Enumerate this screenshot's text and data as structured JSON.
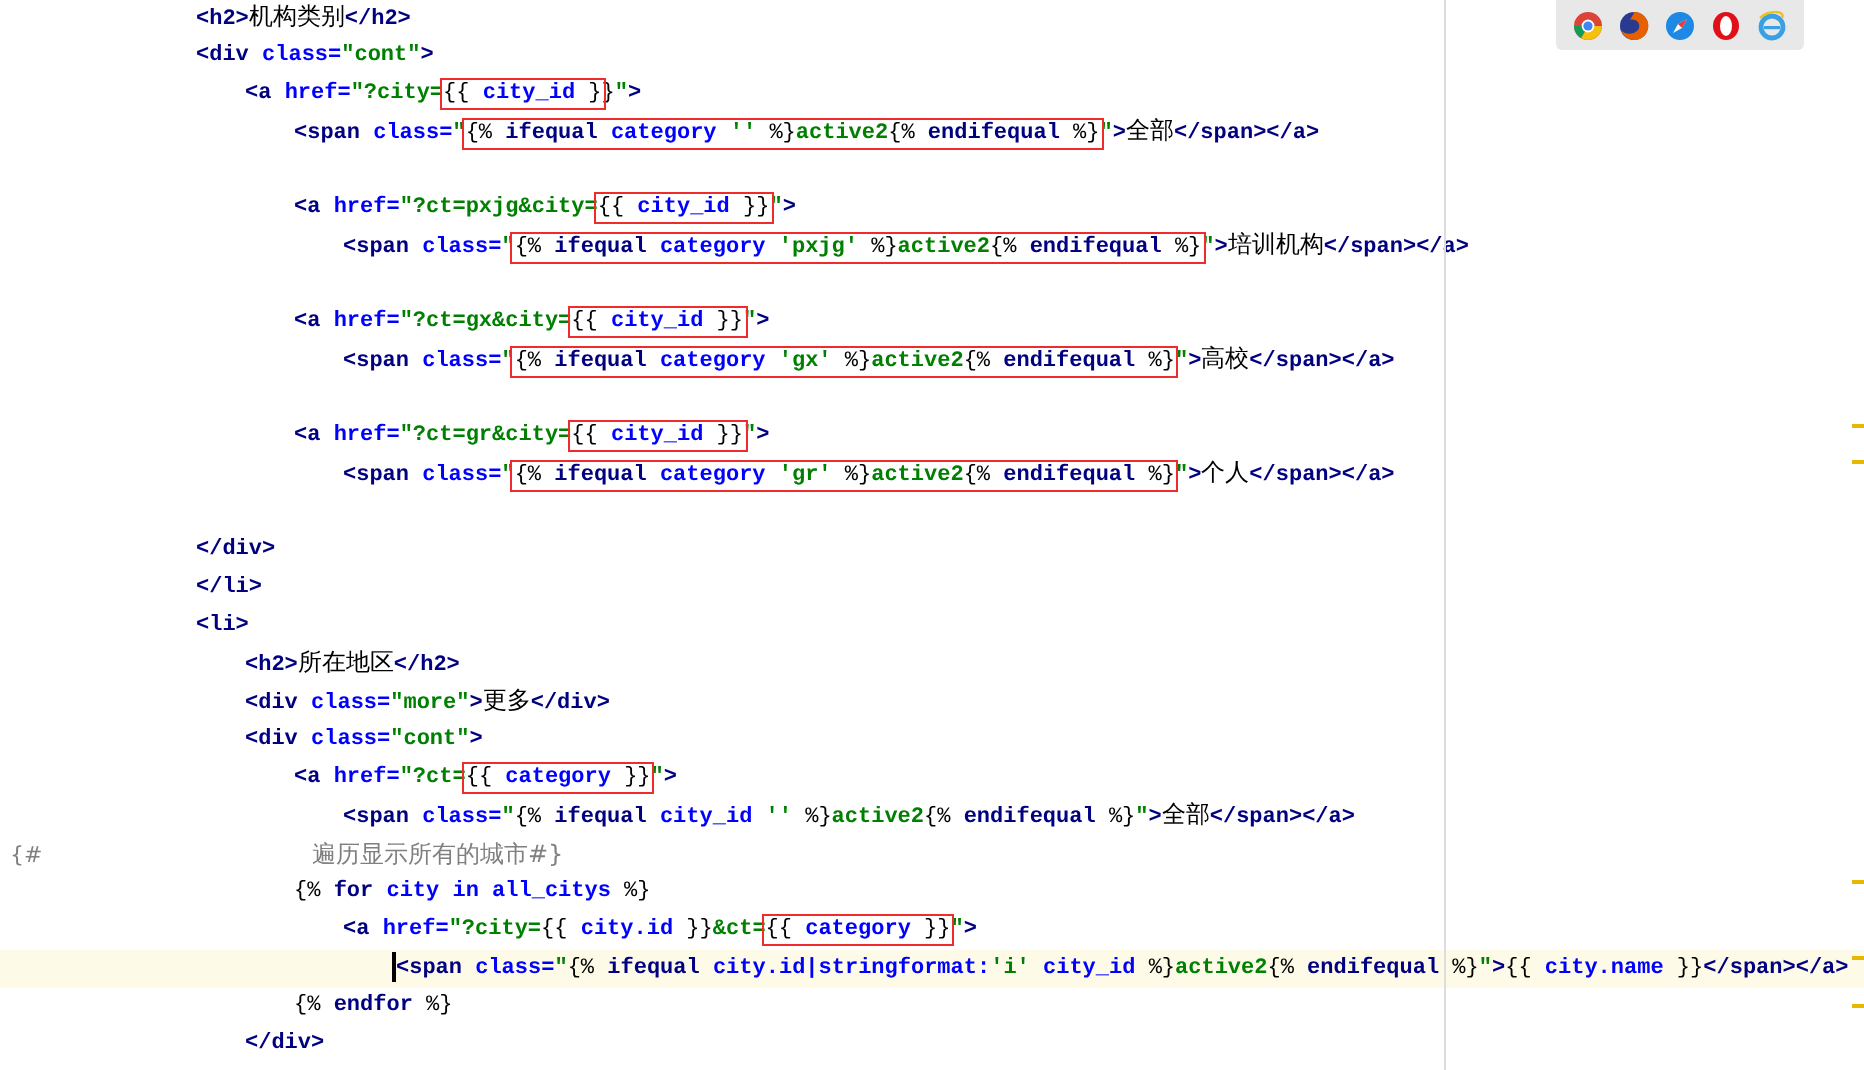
{
  "editor": {
    "lines": [
      {
        "kind": "group",
        "children": [
          {
            "kind": "code",
            "current": false,
            "code": [
              {
                "kind": "tag",
                "text": "<h2>"
              },
              {
                "kind": "text",
                "text": "机构类别"
              },
              {
                "kind": "tag",
                "text": "</h2>"
              }
            ]
          },
          {
            "kind": "code",
            "current": false,
            "code": [
              {
                "kind": "tag",
                "text": "<div "
              },
              {
                "kind": "attr",
                "text": "class="
              },
              {
                "kind": "str",
                "text": "\"cont\""
              },
              {
                "kind": "tag",
                "text": ">"
              }
            ],
            "children": [
              {
                "kind": "code",
                "current": false,
                "code": [
                  {
                    "kind": "tag",
                    "text": "<a "
                  },
                  {
                    "kind": "attr",
                    "text": "href="
                  },
                  {
                    "kind": "str",
                    "text": "\"?city="
                  },
                  {
                    "kind": "box",
                    "parts": [
                      {
                        "kind": "tpl",
                        "text": "{{ "
                      },
                      {
                        "kind": "var",
                        "text": "city_id"
                      },
                      {
                        "kind": "tpl",
                        "text": " }"
                      }
                    ]
                  },
                  {
                    "kind": "tpl",
                    "text": "}"
                  },
                  {
                    "kind": "str",
                    "text": "\""
                  },
                  {
                    "kind": "tag",
                    "text": ">"
                  }
                ],
                "children": [
                  {
                    "kind": "code",
                    "current": false,
                    "code": [
                      {
                        "kind": "tag",
                        "text": "<span "
                      },
                      {
                        "kind": "attr",
                        "text": "class="
                      },
                      {
                        "kind": "str",
                        "text": "\""
                      },
                      {
                        "kind": "box",
                        "parts": [
                          {
                            "kind": "tpl",
                            "text": "{% "
                          },
                          {
                            "kind": "kw",
                            "text": "ifequal"
                          },
                          {
                            "kind": "var",
                            "text": " category "
                          },
                          {
                            "kind": "str",
                            "text": "'' "
                          },
                          {
                            "kind": "tpl",
                            "text": "%}"
                          },
                          {
                            "kind": "str",
                            "text": "active2"
                          },
                          {
                            "kind": "tpl",
                            "text": "{% "
                          },
                          {
                            "kind": "kw",
                            "text": "endifequal"
                          },
                          {
                            "kind": "tpl",
                            "text": " %}"
                          }
                        ]
                      },
                      {
                        "kind": "str",
                        "text": "\""
                      },
                      {
                        "kind": "tag",
                        "text": ">"
                      },
                      {
                        "kind": "text",
                        "text": "全部"
                      },
                      {
                        "kind": "tag",
                        "text": "</span></a>"
                      }
                    ]
                  },
                  {
                    "kind": "blank"
                  },
                  {
                    "kind": "code",
                    "current": false,
                    "code": [
                      {
                        "kind": "tag",
                        "text": "<a "
                      },
                      {
                        "kind": "attr",
                        "text": "href="
                      },
                      {
                        "kind": "str",
                        "text": "\"?ct=pxjg&city="
                      },
                      {
                        "kind": "box",
                        "parts": [
                          {
                            "kind": "tpl",
                            "text": "{{ "
                          },
                          {
                            "kind": "var",
                            "text": "city_id"
                          },
                          {
                            "kind": "tpl",
                            "text": " }}"
                          }
                        ]
                      },
                      {
                        "kind": "str",
                        "text": "\""
                      },
                      {
                        "kind": "tag",
                        "text": ">"
                      }
                    ],
                    "children": [
                      {
                        "kind": "code",
                        "current": false,
                        "code": [
                          {
                            "kind": "tag",
                            "text": "<span "
                          },
                          {
                            "kind": "attr",
                            "text": "class="
                          },
                          {
                            "kind": "str",
                            "text": "\""
                          },
                          {
                            "kind": "box",
                            "parts": [
                              {
                                "kind": "tpl",
                                "text": "{% "
                              },
                              {
                                "kind": "kw",
                                "text": "ifequal"
                              },
                              {
                                "kind": "var",
                                "text": " category "
                              },
                              {
                                "kind": "str",
                                "text": "'pxjg' "
                              },
                              {
                                "kind": "tpl",
                                "text": "%}"
                              },
                              {
                                "kind": "str",
                                "text": "active2"
                              },
                              {
                                "kind": "tpl",
                                "text": "{% "
                              },
                              {
                                "kind": "kw",
                                "text": "endifequal"
                              },
                              {
                                "kind": "tpl",
                                "text": " %}"
                              }
                            ]
                          },
                          {
                            "kind": "str",
                            "text": "\""
                          },
                          {
                            "kind": "tag",
                            "text": ">"
                          },
                          {
                            "kind": "text",
                            "text": "培训机构"
                          },
                          {
                            "kind": "tag",
                            "text": "</span></a>"
                          }
                        ]
                      }
                    ]
                  },
                  {
                    "kind": "blank"
                  },
                  {
                    "kind": "code",
                    "current": false,
                    "code": [
                      {
                        "kind": "tag",
                        "text": "<a "
                      },
                      {
                        "kind": "attr",
                        "text": "href="
                      },
                      {
                        "kind": "str",
                        "text": "\"?ct=gx&city="
                      },
                      {
                        "kind": "box",
                        "parts": [
                          {
                            "kind": "tpl",
                            "text": "{{ "
                          },
                          {
                            "kind": "var",
                            "text": "city_id"
                          },
                          {
                            "kind": "tpl",
                            "text": " }}"
                          }
                        ]
                      },
                      {
                        "kind": "str",
                        "text": "\""
                      },
                      {
                        "kind": "tag",
                        "text": ">"
                      }
                    ],
                    "children": [
                      {
                        "kind": "code",
                        "current": false,
                        "code": [
                          {
                            "kind": "tag",
                            "text": "<span "
                          },
                          {
                            "kind": "attr",
                            "text": "class="
                          },
                          {
                            "kind": "str",
                            "text": "\""
                          },
                          {
                            "kind": "box",
                            "parts": [
                              {
                                "kind": "tpl",
                                "text": "{% "
                              },
                              {
                                "kind": "kw",
                                "text": "ifequal"
                              },
                              {
                                "kind": "var",
                                "text": " category "
                              },
                              {
                                "kind": "str",
                                "text": "'gx' "
                              },
                              {
                                "kind": "tpl",
                                "text": "%}"
                              },
                              {
                                "kind": "str",
                                "text": "active2"
                              },
                              {
                                "kind": "tpl",
                                "text": "{% "
                              },
                              {
                                "kind": "kw",
                                "text": "endifequal"
                              },
                              {
                                "kind": "tpl",
                                "text": " %}"
                              }
                            ]
                          },
                          {
                            "kind": "str",
                            "text": "\""
                          },
                          {
                            "kind": "tag",
                            "text": ">"
                          },
                          {
                            "kind": "text",
                            "text": "高校"
                          },
                          {
                            "kind": "tag",
                            "text": "</span></a>"
                          }
                        ]
                      }
                    ]
                  },
                  {
                    "kind": "blank"
                  },
                  {
                    "kind": "code",
                    "current": false,
                    "code": [
                      {
                        "kind": "tag",
                        "text": "<a "
                      },
                      {
                        "kind": "attr",
                        "text": "href="
                      },
                      {
                        "kind": "str",
                        "text": "\"?ct=gr&city="
                      },
                      {
                        "kind": "box",
                        "parts": [
                          {
                            "kind": "tpl",
                            "text": "{{ "
                          },
                          {
                            "kind": "var",
                            "text": "city_id"
                          },
                          {
                            "kind": "tpl",
                            "text": " }}"
                          }
                        ]
                      },
                      {
                        "kind": "str",
                        "text": "\""
                      },
                      {
                        "kind": "tag",
                        "text": ">"
                      }
                    ],
                    "children": [
                      {
                        "kind": "code",
                        "current": false,
                        "code": [
                          {
                            "kind": "tag",
                            "text": "<span "
                          },
                          {
                            "kind": "attr",
                            "text": "class="
                          },
                          {
                            "kind": "str",
                            "text": "\""
                          },
                          {
                            "kind": "box",
                            "parts": [
                              {
                                "kind": "tpl",
                                "text": "{% "
                              },
                              {
                                "kind": "kw",
                                "text": "ifequal"
                              },
                              {
                                "kind": "var",
                                "text": " category "
                              },
                              {
                                "kind": "str",
                                "text": "'gr' "
                              },
                              {
                                "kind": "tpl",
                                "text": "%}"
                              },
                              {
                                "kind": "str",
                                "text": "active2"
                              },
                              {
                                "kind": "tpl",
                                "text": "{% "
                              },
                              {
                                "kind": "kw",
                                "text": "endifequal"
                              },
                              {
                                "kind": "tpl",
                                "text": " %}"
                              }
                            ]
                          },
                          {
                            "kind": "str",
                            "text": "\""
                          },
                          {
                            "kind": "tag",
                            "text": ">"
                          },
                          {
                            "kind": "text",
                            "text": "个人"
                          },
                          {
                            "kind": "tag",
                            "text": "</span></a>"
                          }
                        ]
                      }
                    ]
                  },
                  {
                    "kind": "blank"
                  }
                ]
              }
            ]
          },
          {
            "kind": "code",
            "current": false,
            "code": [
              {
                "kind": "tag",
                "text": "</div>"
              }
            ]
          }
        ]
      },
      {
        "kind": "code",
        "current": false,
        "code": [
          {
            "kind": "tag",
            "text": "</li>"
          }
        ]
      },
      {
        "kind": "code",
        "current": false,
        "code": [
          {
            "kind": "tag",
            "text": "<li>"
          }
        ],
        "children": [
          {
            "kind": "code",
            "current": false,
            "code": [
              {
                "kind": "tag",
                "text": "<h2>"
              },
              {
                "kind": "text",
                "text": "所在地区"
              },
              {
                "kind": "tag",
                "text": "</h2>"
              }
            ]
          },
          {
            "kind": "code",
            "current": false,
            "code": [
              {
                "kind": "tag",
                "text": "<div "
              },
              {
                "kind": "attr",
                "text": "class="
              },
              {
                "kind": "str",
                "text": "\"more\""
              },
              {
                "kind": "tag",
                "text": ">"
              },
              {
                "kind": "text",
                "text": "更多"
              },
              {
                "kind": "tag",
                "text": "</div>"
              }
            ]
          },
          {
            "kind": "code",
            "current": false,
            "code": [
              {
                "kind": "tag",
                "text": "<div "
              },
              {
                "kind": "attr",
                "text": "class="
              },
              {
                "kind": "str",
                "text": "\"cont\""
              },
              {
                "kind": "tag",
                "text": ">"
              }
            ],
            "children": [
              {
                "kind": "code",
                "current": false,
                "code": [
                  {
                    "kind": "tag",
                    "text": "<a "
                  },
                  {
                    "kind": "attr",
                    "text": "href="
                  },
                  {
                    "kind": "str",
                    "text": "\"?ct="
                  },
                  {
                    "kind": "box",
                    "parts": [
                      {
                        "kind": "tpl",
                        "text": "{{ "
                      },
                      {
                        "kind": "var",
                        "text": "category"
                      },
                      {
                        "kind": "tpl",
                        "text": " }}"
                      }
                    ]
                  },
                  {
                    "kind": "str",
                    "text": "\""
                  },
                  {
                    "kind": "tag",
                    "text": ">"
                  }
                ],
                "children": [
                  {
                    "kind": "code",
                    "current": false,
                    "code": [
                      {
                        "kind": "tag",
                        "text": "<span "
                      },
                      {
                        "kind": "attr",
                        "text": "class="
                      },
                      {
                        "kind": "str",
                        "text": "\""
                      },
                      {
                        "kind": "tpl",
                        "text": "{% "
                      },
                      {
                        "kind": "kw",
                        "text": "ifequal"
                      },
                      {
                        "kind": "var",
                        "text": " city_id "
                      },
                      {
                        "kind": "str",
                        "text": "'' "
                      },
                      {
                        "kind": "tpl",
                        "text": "%}"
                      },
                      {
                        "kind": "str",
                        "text": "active2"
                      },
                      {
                        "kind": "tpl",
                        "text": "{% "
                      },
                      {
                        "kind": "kw",
                        "text": "endifequal"
                      },
                      {
                        "kind": "tpl",
                        "text": " %}"
                      },
                      {
                        "kind": "str",
                        "text": "\""
                      },
                      {
                        "kind": "tag",
                        "text": ">"
                      },
                      {
                        "kind": "text",
                        "text": "全部"
                      },
                      {
                        "kind": "tag",
                        "text": "</span></a>"
                      }
                    ]
                  }
                ]
              },
              {
                "kind": "comment",
                "prefix": "{#",
                "text": "遍历显示所有的城市#}"
              },
              {
                "kind": "code",
                "current": false,
                "code": [
                  {
                    "kind": "tpl",
                    "text": "{% "
                  },
                  {
                    "kind": "kw",
                    "text": "for"
                  },
                  {
                    "kind": "var",
                    "text": " city in all_citys "
                  },
                  {
                    "kind": "tpl",
                    "text": "%}"
                  }
                ],
                "children": [
                  {
                    "kind": "code",
                    "current": false,
                    "code": [
                      {
                        "kind": "tag",
                        "text": "<a "
                      },
                      {
                        "kind": "attr",
                        "text": "href="
                      },
                      {
                        "kind": "str",
                        "text": "\"?city="
                      },
                      {
                        "kind": "tpl",
                        "text": "{{ "
                      },
                      {
                        "kind": "var",
                        "text": "city.id"
                      },
                      {
                        "kind": "tpl",
                        "text": " }}"
                      },
                      {
                        "kind": "str",
                        "text": "&ct="
                      },
                      {
                        "kind": "box",
                        "parts": [
                          {
                            "kind": "tpl",
                            "text": "{{ "
                          },
                          {
                            "kind": "var",
                            "text": "category"
                          },
                          {
                            "kind": "tpl",
                            "text": " }}"
                          }
                        ]
                      },
                      {
                        "kind": "str",
                        "text": "\""
                      },
                      {
                        "kind": "tag",
                        "text": ">"
                      }
                    ],
                    "children": [
                      {
                        "kind": "code",
                        "current": true,
                        "code": [
                          {
                            "kind": "tag",
                            "text": "<span "
                          },
                          {
                            "kind": "attr",
                            "text": "class="
                          },
                          {
                            "kind": "str",
                            "text": "\""
                          },
                          {
                            "kind": "tpl",
                            "text": "{% "
                          },
                          {
                            "kind": "kw",
                            "text": "ifequal"
                          },
                          {
                            "kind": "var",
                            "text": " city.id|stringformat:"
                          },
                          {
                            "kind": "str",
                            "text": "'i' "
                          },
                          {
                            "kind": "var",
                            "text": "city_id "
                          },
                          {
                            "kind": "tpl",
                            "text": "%}"
                          },
                          {
                            "kind": "str",
                            "text": "active2"
                          },
                          {
                            "kind": "tpl",
                            "text": "{% "
                          },
                          {
                            "kind": "kw",
                            "text": "endifequal"
                          },
                          {
                            "kind": "tpl",
                            "text": " %}"
                          },
                          {
                            "kind": "str",
                            "text": "\""
                          },
                          {
                            "kind": "tag",
                            "text": ">"
                          },
                          {
                            "kind": "tpl",
                            "text": "{{ "
                          },
                          {
                            "kind": "var",
                            "text": "city.name"
                          },
                          {
                            "kind": "tpl",
                            "text": " }}"
                          },
                          {
                            "kind": "tag",
                            "text": "</span></a>"
                          }
                        ]
                      }
                    ]
                  }
                ]
              },
              {
                "kind": "code",
                "current": false,
                "code": [
                  {
                    "kind": "tpl",
                    "text": "{% "
                  },
                  {
                    "kind": "kw",
                    "text": "endfor"
                  },
                  {
                    "kind": "tpl",
                    "text": " %}"
                  }
                ]
              }
            ]
          },
          {
            "kind": "code",
            "current": false,
            "code": [
              {
                "kind": "tag",
                "text": "</div>"
              }
            ]
          }
        ]
      }
    ]
  }
}
